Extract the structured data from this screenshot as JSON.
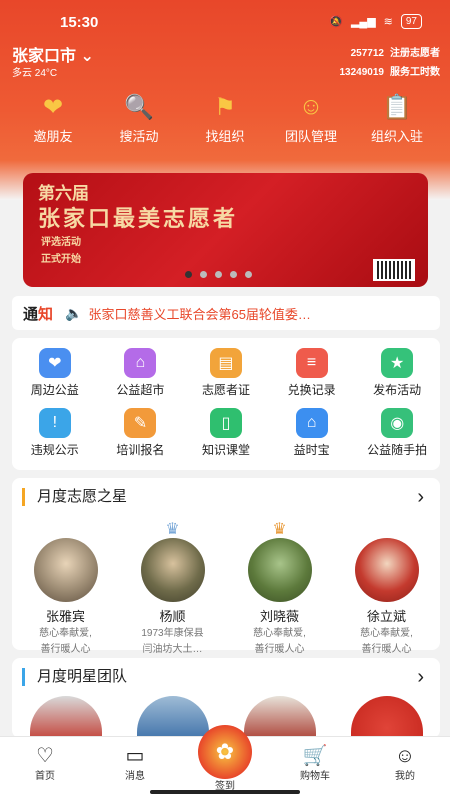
{
  "status": {
    "time": "15:30",
    "battery": "97",
    "icons": [
      "mute-icon",
      "signal-icon",
      "wifi-icon",
      "battery-icon"
    ]
  },
  "location": {
    "city": "张家口市",
    "weather": "多云 24°C"
  },
  "stats": [
    {
      "num": "257712",
      "label": "注册志愿者"
    },
    {
      "num": "13249019",
      "label": "服务工时数"
    }
  ],
  "quick": [
    {
      "label": "邀朋友",
      "icon": "invite-icon"
    },
    {
      "label": "搜活动",
      "icon": "search-icon"
    },
    {
      "label": "找组织",
      "icon": "flag-icon"
    },
    {
      "label": "团队管理",
      "icon": "team-icon"
    },
    {
      "label": "组织入驻",
      "icon": "clipboard-icon"
    }
  ],
  "banner": {
    "line1": "第六届",
    "line2": "张家口最美志愿者",
    "line3": "评选活动",
    "line4": "正式开始"
  },
  "notice": {
    "tag1": "通",
    "tag2": "知",
    "text": "张家口慈善义工联合会第65届轮值委…"
  },
  "services": [
    {
      "label": "周边公益",
      "color": "#4a8ff0"
    },
    {
      "label": "公益超市",
      "color": "#b46be8"
    },
    {
      "label": "志愿者证",
      "color": "#f2a43a"
    },
    {
      "label": "兑换记录",
      "color": "#ef5b4c"
    },
    {
      "label": "发布活动",
      "color": "#35c27a"
    },
    {
      "label": "违规公示",
      "color": "#3ba5e8"
    },
    {
      "label": "培训报名",
      "color": "#f29a3a"
    },
    {
      "label": "知识课堂",
      "color": "#2fbf6f"
    },
    {
      "label": "益时宝",
      "color": "#3c8ff0"
    },
    {
      "label": "公益随手拍",
      "color": "#36c07a"
    }
  ],
  "stars_card": {
    "title": "月度志愿之星",
    "items": [
      {
        "name": "张雅宾",
        "desc1": "慈心奉献爱,",
        "desc2": "善行暖人心"
      },
      {
        "name": "杨顺",
        "desc1": "1973年康保县",
        "desc2": "闫油坊大土…"
      },
      {
        "name": "刘晓薇",
        "desc1": "慈心奉献爱,",
        "desc2": "善行暖人心"
      },
      {
        "name": "徐立斌",
        "desc1": "慈心奉献爱,",
        "desc2": "善行暖人心"
      }
    ]
  },
  "team_card": {
    "title": "月度明星团队"
  },
  "tabs": {
    "home": "首页",
    "message": "消息",
    "checkin": "签到",
    "cart": "购物车",
    "mine": "我的"
  }
}
